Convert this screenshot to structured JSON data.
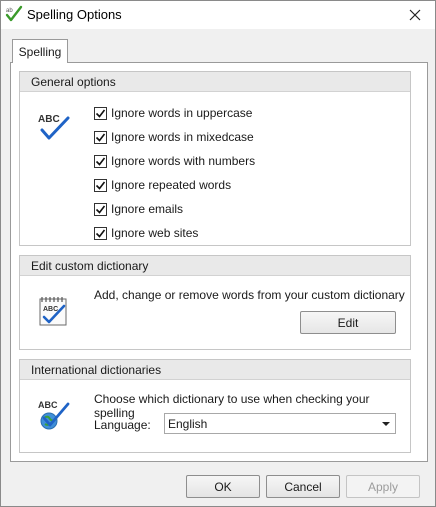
{
  "window": {
    "title": "Spelling Options"
  },
  "tabs": [
    {
      "label": "Spelling",
      "selected": true
    }
  ],
  "general": {
    "header": "General options",
    "options": [
      {
        "label": "Ignore words in uppercase",
        "checked": true
      },
      {
        "label": "Ignore words in mixedcase",
        "checked": true
      },
      {
        "label": "Ignore words with numbers",
        "checked": true
      },
      {
        "label": "Ignore repeated words",
        "checked": true
      },
      {
        "label": "Ignore emails",
        "checked": true
      },
      {
        "label": "Ignore web sites",
        "checked": true
      }
    ]
  },
  "custom_dictionary": {
    "header": "Edit custom dictionary",
    "description": "Add, change or remove words from your custom dictionary",
    "edit_label": "Edit"
  },
  "international": {
    "header": "International dictionaries",
    "description": "Choose which dictionary to use when checking your spelling",
    "language_label": "Language:",
    "language_value": "English"
  },
  "footer": {
    "ok_label": "OK",
    "cancel_label": "Cancel",
    "apply_label": "Apply",
    "apply_enabled": false
  },
  "icons": {
    "app": "spell-check-icon",
    "close": "close-icon",
    "general": "abc-check-icon",
    "custom_dictionary": "notebook-abc-icon",
    "international": "abc-globe-icon",
    "dropdown": "chevron-down-icon"
  },
  "colors": {
    "accent": "#1f63c6",
    "group_header_bg": "#e9e9e9",
    "window_bg": "#f0f0f0"
  }
}
